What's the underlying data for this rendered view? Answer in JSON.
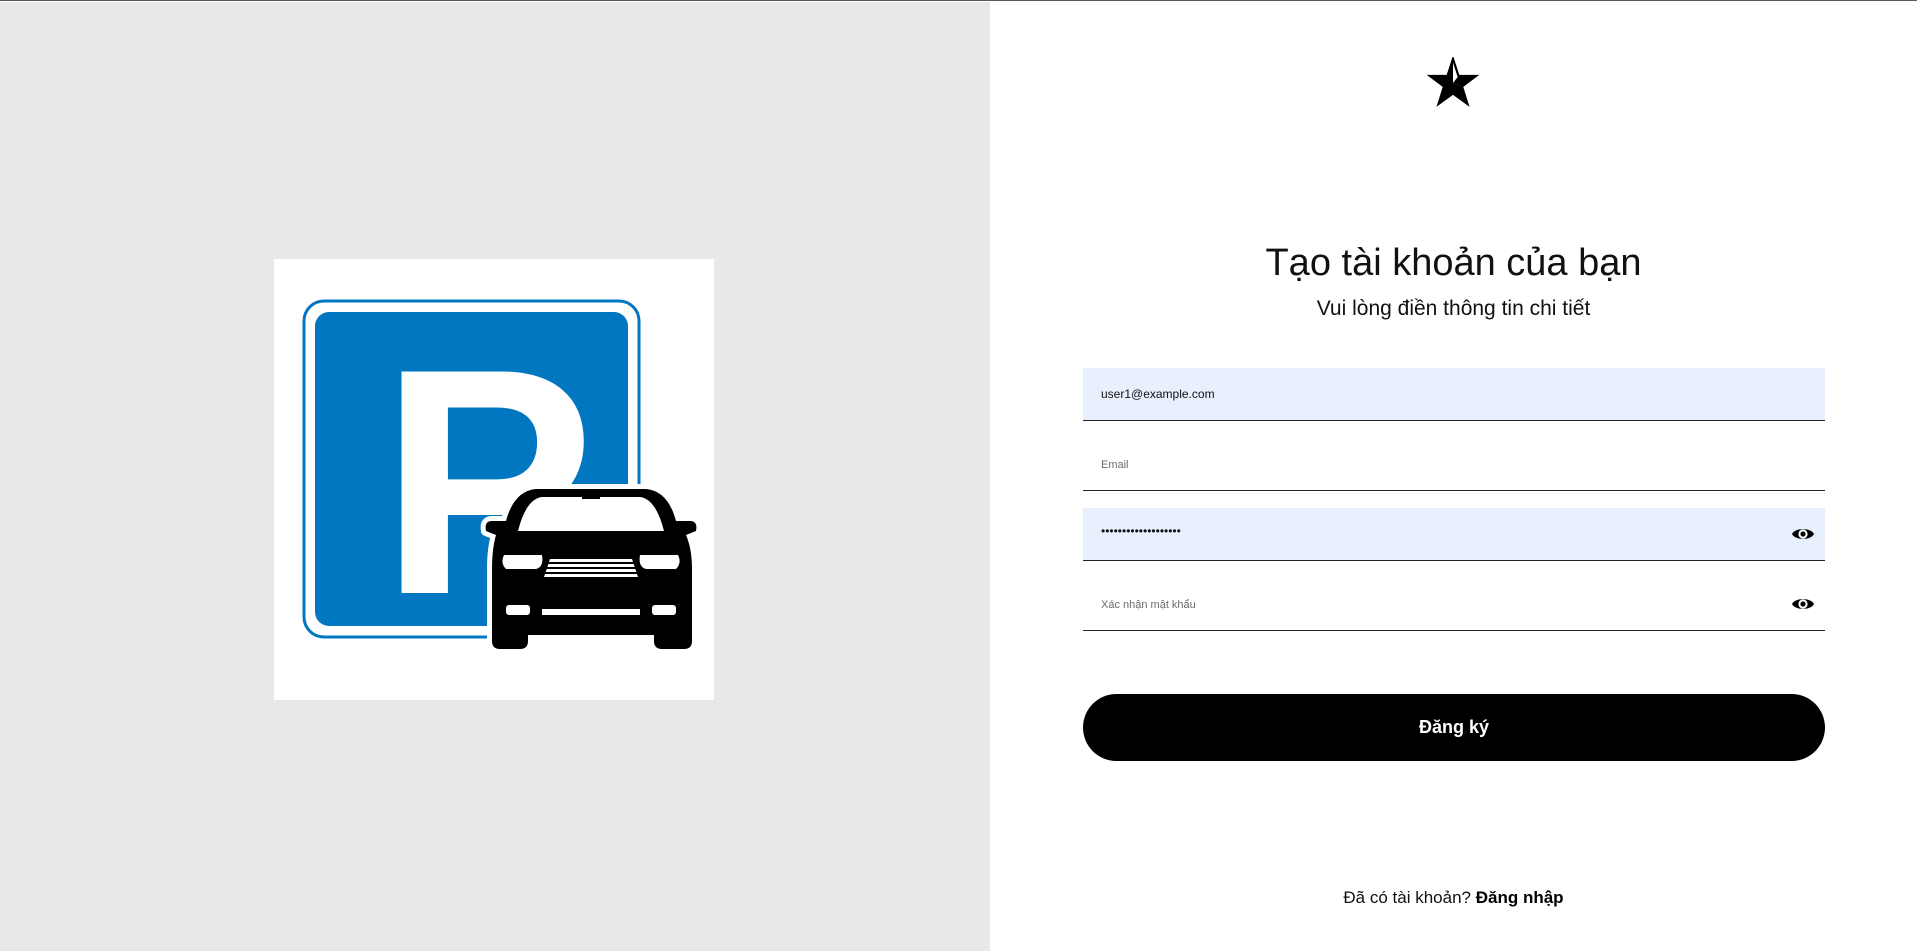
{
  "illustration": {
    "sign_letter": "P",
    "sign_color": "#0077c0",
    "icon": "parking-sign-with-car"
  },
  "logo": {
    "icon": "star-icon"
  },
  "heading": {
    "title": "Tạo tài khoản của bạn",
    "subtitle": "Vui lòng điền thông tin chi tiết"
  },
  "form": {
    "username": {
      "value": "user1@example.com",
      "placeholder": ""
    },
    "email": {
      "value": "",
      "placeholder": "Email"
    },
    "password": {
      "masked": "•••••••••••••••••••"
    },
    "confirm_password": {
      "value": "",
      "placeholder": "Xác nhận mật khẩu"
    },
    "submit_label": "Đăng ký"
  },
  "footer": {
    "prompt": "Đã có tài khoản?",
    "link_label": "Đăng nhập"
  },
  "colors": {
    "left_bg": "#e8e8e8",
    "autofill_bg": "#e8f0fe",
    "button_bg": "#000000"
  }
}
